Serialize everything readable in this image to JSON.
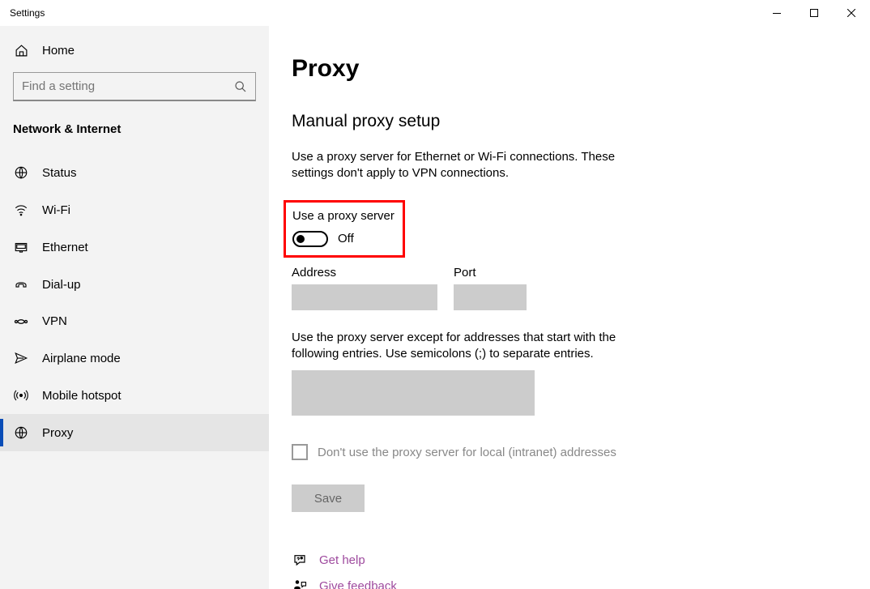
{
  "titlebar": {
    "title": "Settings"
  },
  "sidebar": {
    "home_label": "Home",
    "search_placeholder": "Find a setting",
    "category": "Network & Internet",
    "items": [
      {
        "label": "Status"
      },
      {
        "label": "Wi-Fi"
      },
      {
        "label": "Ethernet"
      },
      {
        "label": "Dial-up"
      },
      {
        "label": "VPN"
      },
      {
        "label": "Airplane mode"
      },
      {
        "label": "Mobile hotspot"
      },
      {
        "label": "Proxy",
        "selected": true
      }
    ]
  },
  "content": {
    "page_title": "Proxy",
    "section_title": "Manual proxy setup",
    "description": "Use a proxy server for Ethernet or Wi-Fi connections. These settings don't apply to VPN connections.",
    "toggle_label": "Use a proxy server",
    "toggle_state": "Off",
    "address_label": "Address",
    "address_value": "",
    "port_label": "Port",
    "port_value": "",
    "exceptions_description": "Use the proxy server except for addresses that start with the following entries. Use semicolons (;) to separate entries.",
    "exceptions_value": "",
    "checkbox_label": "Don't use the proxy server for local (intranet) addresses",
    "checkbox_checked": false,
    "save_label": "Save",
    "help_label": "Get help",
    "feedback_label": "Give feedback"
  }
}
